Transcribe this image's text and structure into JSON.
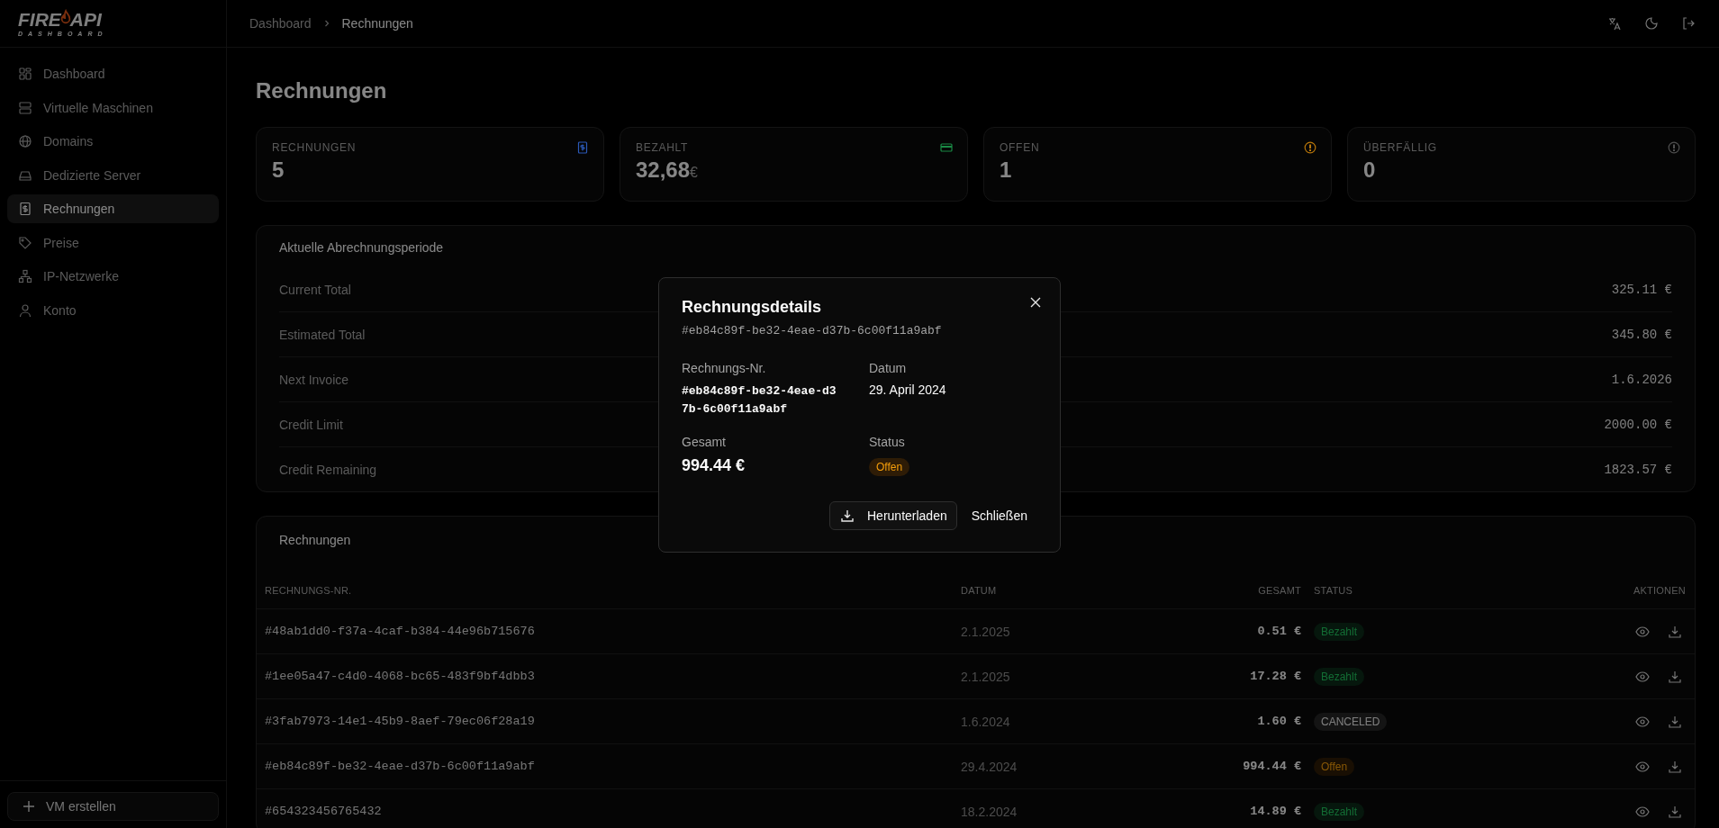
{
  "logo": {
    "left": "FIRE",
    "right": "API",
    "subtitle": "DASHBOARD"
  },
  "sidebar": {
    "items": [
      {
        "label": "Dashboard",
        "selected": false
      },
      {
        "label": "Virtuelle Maschinen",
        "selected": false
      },
      {
        "label": "Domains",
        "selected": false
      },
      {
        "label": "Dedizierte Server",
        "selected": false
      },
      {
        "label": "Rechnungen",
        "selected": true
      },
      {
        "label": "Preise",
        "selected": false
      },
      {
        "label": "IP-Netzwerke",
        "selected": false
      },
      {
        "label": "Konto",
        "selected": false
      }
    ],
    "create_button": "VM erstellen"
  },
  "breadcrumb": [
    "Dashboard",
    "Rechnungen"
  ],
  "page_title": "Rechnungen",
  "stats": [
    {
      "label": "RECHNUNGEN",
      "value": "5",
      "kind": "invoice",
      "color": "#2b59b8"
    },
    {
      "label": "BEZAHLT",
      "value": "32,68",
      "unit": "€",
      "kind": "card",
      "color": "#1a8a45"
    },
    {
      "label": "OFFEN",
      "value": "1",
      "kind": "alert",
      "color": "#b8760a"
    },
    {
      "label": "ÜBERFÄLLIG",
      "value": "0",
      "kind": "alert",
      "color": "#505050"
    }
  ],
  "billing": {
    "title": "Aktuelle Abrechnungsperiode",
    "rows": [
      {
        "label": "Current Total",
        "value": "325.11 €"
      },
      {
        "label": "Estimated Total",
        "value": "345.80 €"
      },
      {
        "label": "Next Invoice",
        "value": "1.6.2026"
      },
      {
        "label": "Credit Limit",
        "value": "2000.00 €"
      },
      {
        "label": "Credit Remaining",
        "value": "1823.57 €"
      }
    ]
  },
  "invoices": {
    "title": "Rechnungen",
    "columns": [
      "RECHNUNGS-NR.",
      "DATUM",
      "GESAMT",
      "STATUS",
      "AKTIONEN"
    ],
    "rows": [
      {
        "id": "#48ab1dd0-f37a-4caf-b384-44e96b715676",
        "date": "2.1.2025",
        "total": "0.51 €",
        "status": "Bezahlt",
        "kind": "paid"
      },
      {
        "id": "#1ee05a47-c4d0-4068-bc65-483f9bf4dbb3",
        "date": "2.1.2025",
        "total": "17.28 €",
        "status": "Bezahlt",
        "kind": "paid"
      },
      {
        "id": "#3fab7973-14e1-45b9-8aef-79ec06f28a19",
        "date": "1.6.2024",
        "total": "1.60 €",
        "status": "CANCELED",
        "kind": "canceled"
      },
      {
        "id": "#eb84c89f-be32-4eae-d37b-6c00f11a9abf",
        "date": "29.4.2024",
        "total": "994.44 €",
        "status": "Offen",
        "kind": "open"
      },
      {
        "id": "#654323456765432",
        "date": "18.2.2024",
        "total": "14.89 €",
        "status": "Bezahlt",
        "kind": "paid"
      }
    ]
  },
  "modal": {
    "title": "Rechnungsdetails",
    "subtitle": "#eb84c89f-be32-4eae-d37b-6c00f11a9abf",
    "number_label": "Rechnungs-Nr.",
    "number": "#eb84c89f-be32-4eae-d37b-6c00f11a9abf",
    "date_label": "Datum",
    "date": "29. April 2024",
    "total_label": "Gesamt",
    "total": "994.44 €",
    "status_label": "Status",
    "status": {
      "text": "Offen",
      "kind": "open"
    },
    "download_button": "Herunterladen",
    "close_button": "Schließen"
  }
}
